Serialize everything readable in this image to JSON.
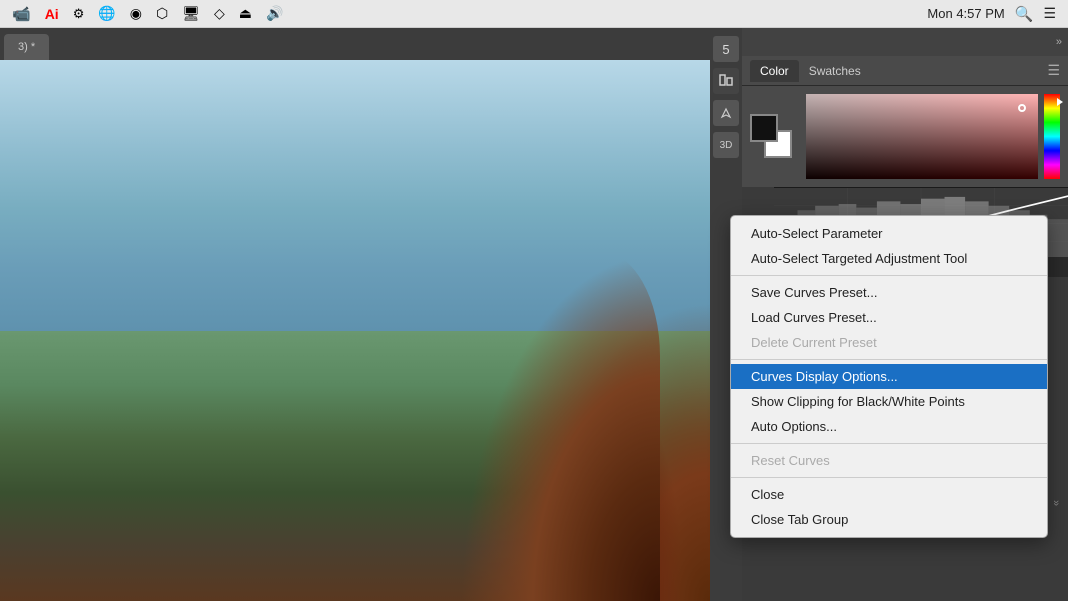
{
  "menubar": {
    "time": "Mon 4:57 PM",
    "icons": [
      "video-icon",
      "creative-cloud-icon",
      "typekit-icon",
      "bridge-icon",
      "behance-icon",
      "behance2-icon",
      "display-icon",
      "airdrop-icon",
      "eject-icon",
      "volume-icon",
      "spotlight-icon",
      "notifications-icon"
    ]
  },
  "tab": {
    "label": "3) *"
  },
  "color_panel": {
    "tabs": [
      "Color",
      "Swatches"
    ],
    "active_tab": "Color"
  },
  "context_menu": {
    "items": [
      {
        "id": "auto-select-param",
        "label": "Auto-Select Parameter",
        "disabled": false,
        "highlighted": false,
        "separator_after": false
      },
      {
        "id": "auto-select-targeted",
        "label": "Auto-Select Targeted Adjustment Tool",
        "disabled": false,
        "highlighted": false,
        "separator_after": true
      },
      {
        "id": "save-curves-preset",
        "label": "Save Curves Preset...",
        "disabled": false,
        "highlighted": false,
        "separator_after": false
      },
      {
        "id": "load-curves-preset",
        "label": "Load Curves Preset...",
        "disabled": false,
        "highlighted": false,
        "separator_after": false
      },
      {
        "id": "delete-current-preset",
        "label": "Delete Current Preset",
        "disabled": true,
        "highlighted": false,
        "separator_after": true
      },
      {
        "id": "curves-display-options",
        "label": "Curves Display Options...",
        "disabled": false,
        "highlighted": true,
        "separator_after": false
      },
      {
        "id": "show-clipping",
        "label": "Show Clipping for Black/White Points",
        "disabled": false,
        "highlighted": false,
        "separator_after": false
      },
      {
        "id": "auto-options",
        "label": "Auto Options...",
        "disabled": false,
        "highlighted": false,
        "separator_after": true
      },
      {
        "id": "reset-curves",
        "label": "Reset Curves",
        "disabled": true,
        "highlighted": false,
        "separator_after": true
      },
      {
        "id": "close",
        "label": "Close",
        "disabled": false,
        "highlighted": false,
        "separator_after": false
      },
      {
        "id": "close-tab-group",
        "label": "Close Tab Group",
        "disabled": false,
        "highlighted": false,
        "separator_after": false
      }
    ]
  }
}
